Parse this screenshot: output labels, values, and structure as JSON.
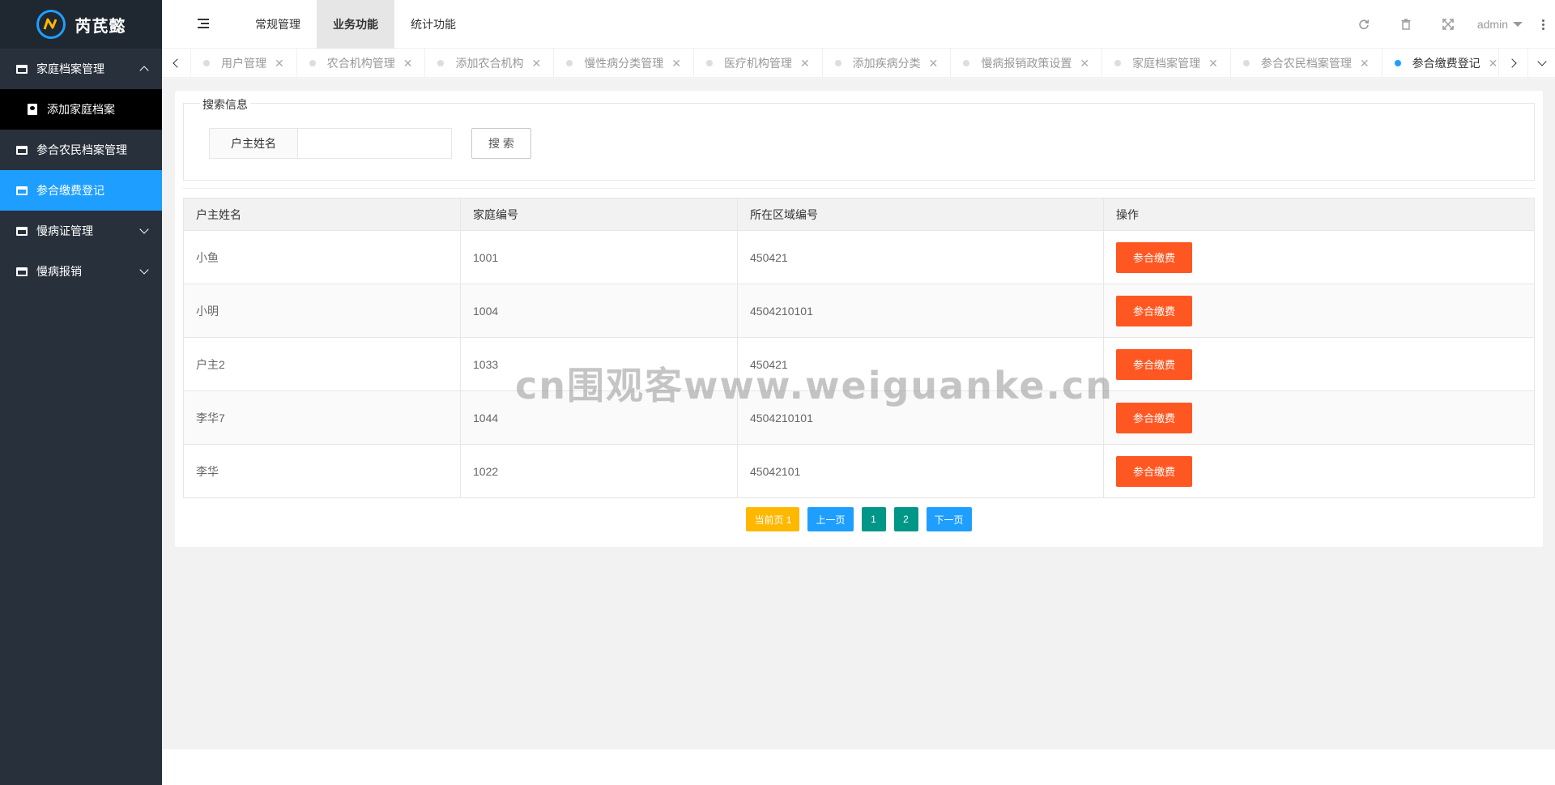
{
  "app": {
    "logo_text": "芮芪懿"
  },
  "sidebar": {
    "items": [
      {
        "label": "家庭档案管理",
        "expanded": true,
        "sub": [
          {
            "label": "添加家庭档案"
          }
        ]
      },
      {
        "label": "参合农民档案管理"
      },
      {
        "label": "参合缴费登记",
        "active": true
      },
      {
        "label": "慢病证管理",
        "expandable": true
      },
      {
        "label": "慢病报销",
        "expandable": true
      }
    ]
  },
  "header": {
    "menu": [
      {
        "label": "常规管理"
      },
      {
        "label": "业务功能",
        "active": true
      },
      {
        "label": "统计功能"
      }
    ],
    "user": "admin",
    "icons": [
      "refresh-icon",
      "trash-icon",
      "fullscreen-icon",
      "more-vertical-icon"
    ]
  },
  "tabs": [
    {
      "label": "用户管理"
    },
    {
      "label": "农合机构管理"
    },
    {
      "label": "添加农合机构"
    },
    {
      "label": "慢性病分类管理"
    },
    {
      "label": "医疗机构管理"
    },
    {
      "label": "添加疾病分类"
    },
    {
      "label": "慢病报销政策设置"
    },
    {
      "label": "家庭档案管理"
    },
    {
      "label": "参合农民档案管理"
    },
    {
      "label": "参合缴费登记",
      "active": true
    }
  ],
  "search": {
    "legend": "搜索信息",
    "label": "户主姓名",
    "value": "",
    "button": "搜 索"
  },
  "table": {
    "headers": [
      "户主姓名",
      "家庭编号",
      "所在区域编号",
      "操作"
    ],
    "rows": [
      {
        "name": "小鱼",
        "family_no": "1001",
        "area_no": "450421",
        "action": "参合缴费"
      },
      {
        "name": "小明",
        "family_no": "1004",
        "area_no": "4504210101",
        "action": "参合缴费"
      },
      {
        "name": "户主2",
        "family_no": "1033",
        "area_no": "450421",
        "action": "参合缴费"
      },
      {
        "name": "李华7",
        "family_no": "1044",
        "area_no": "4504210101",
        "action": "参合缴费"
      },
      {
        "name": "李华",
        "family_no": "1022",
        "area_no": "45042101",
        "action": "参合缴费"
      }
    ]
  },
  "pager": {
    "current": "当前页 1",
    "prev": "上一页",
    "pages": [
      "1",
      "2"
    ],
    "next": "下一页"
  },
  "watermark": "cn围观客www.weiguanke.cn",
  "colors": {
    "accent": "#1e9fff",
    "danger": "#ff5722",
    "warn": "#ffb800",
    "teal": "#009688",
    "sidebar": "#28313b"
  }
}
